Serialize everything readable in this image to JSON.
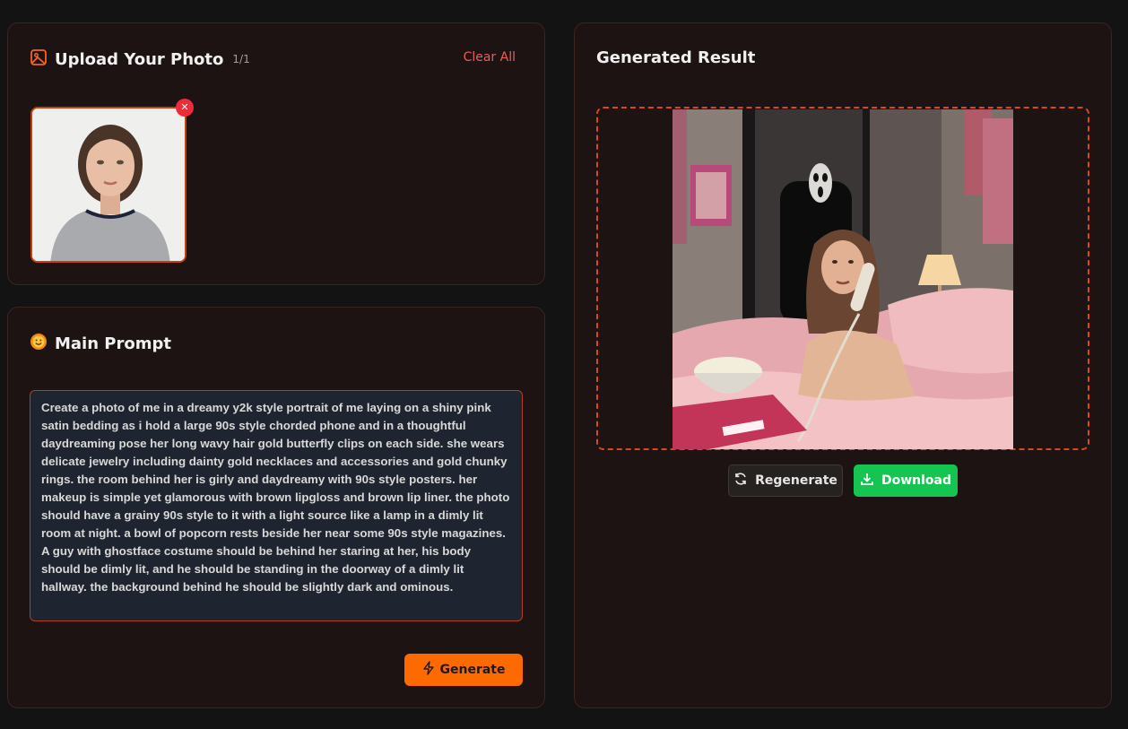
{
  "upload": {
    "title": "Upload Your Photo",
    "count": "1/1",
    "clear_label": "Clear All",
    "remove_glyph": "✕",
    "icon": "image-icon"
  },
  "prompt": {
    "title": "Main Prompt",
    "icon": "smiley-icon",
    "text": "Create a photo of me in a dreamy y2k style portrait of me laying on a shiny pink satin bedding as i hold a large 90s style chorded phone and in a thoughtful daydreaming pose her long wavy hair gold butterfly clips on each side. she wears delicate jewelry including dainty gold necklaces and accessories and gold chunky rings. the room behind her is girly and daydreamy with 90s style posters. her makeup is simple yet glamorous with brown lipgloss and brown lip liner. the photo should have a grainy 90s style to it with a light source like a lamp in a dimly lit room at night. a bowl of popcorn rests beside her near some 90s style magazines. A guy with ghostface costume should be behind her staring at her, his body should be dimly lit, and he should be standing in the doorway of a dimly lit hallway. the background behind he should be slightly dark and ominous.",
    "generate_label": "Generate"
  },
  "result": {
    "title": "Generated Result",
    "regenerate_label": "Regenerate",
    "download_label": "Download"
  },
  "colors": {
    "accent": "#ff6a00",
    "download": "#16c451",
    "danger": "#ef2b3a",
    "panel_bg": "#1c1312"
  }
}
